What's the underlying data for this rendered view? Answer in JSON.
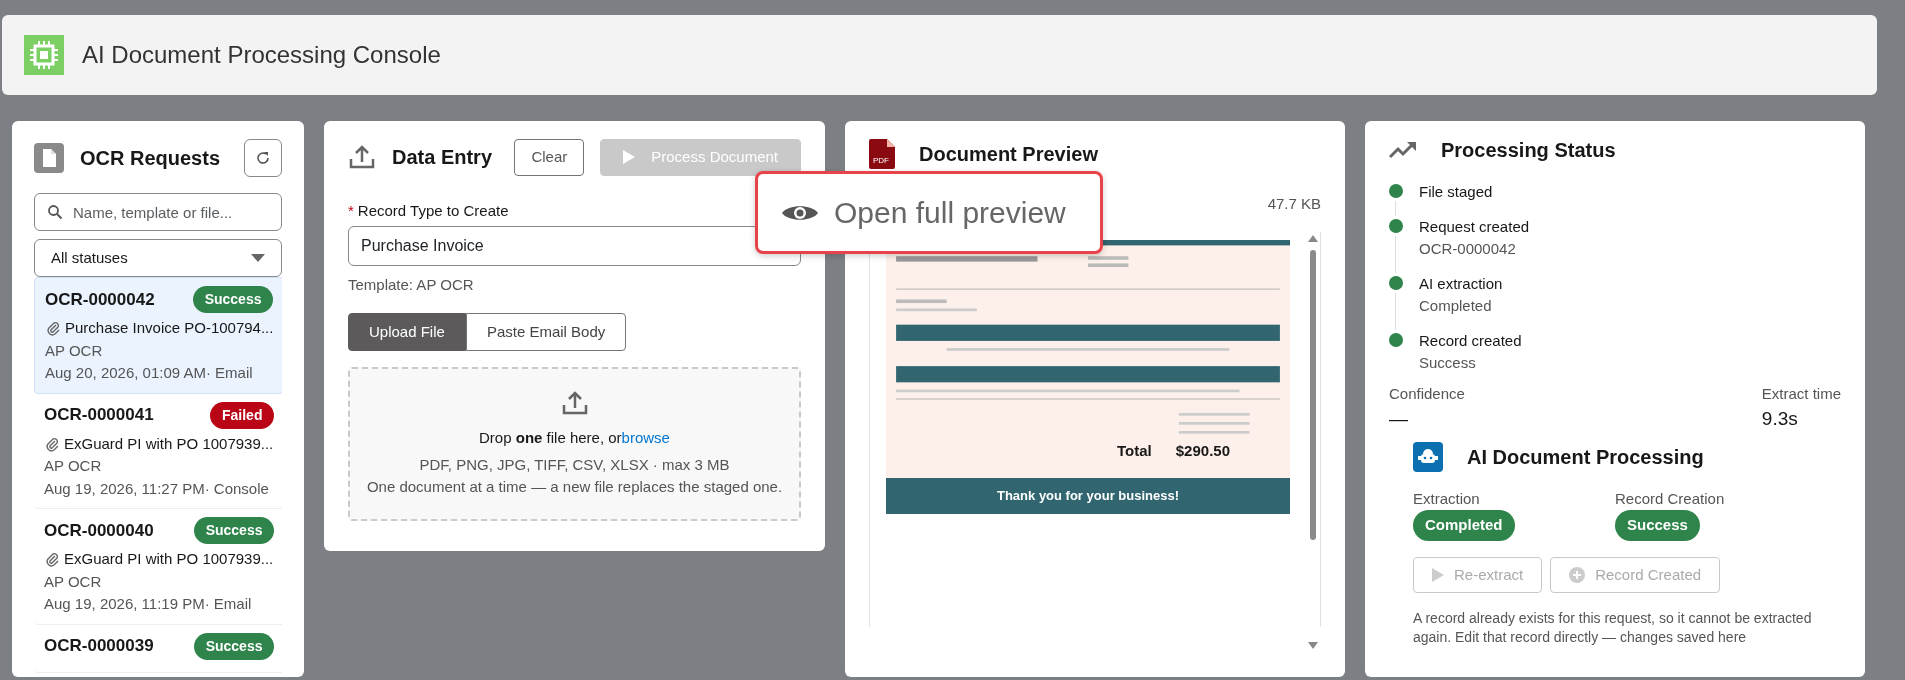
{
  "header": {
    "title": "AI Document Processing Console"
  },
  "requests": {
    "title": "OCR Requests",
    "search": {
      "placeholder": "Name, template or file..."
    },
    "status_filter": "All statuses",
    "items": [
      {
        "id": "OCR-0000042",
        "status": "Success",
        "kind": "success",
        "file": "Purchase Invoice PO-100794...",
        "template": "AP OCR",
        "meta": "Aug 20, 2026, 01:09 AM· Email",
        "selected": true
      },
      {
        "id": "OCR-0000041",
        "status": "Failed",
        "kind": "failed",
        "file": "ExGuard PI with PO 1007939...",
        "template": "AP OCR",
        "meta": "Aug 19, 2026, 11:27 PM· Console",
        "selected": false
      },
      {
        "id": "OCR-0000040",
        "status": "Success",
        "kind": "success",
        "file": "ExGuard PI with PO 1007939...",
        "template": "AP OCR",
        "meta": "Aug 19, 2026, 11:19 PM· Email",
        "selected": false
      },
      {
        "id": "OCR-0000039",
        "status": "Success",
        "kind": "success",
        "selected": false
      }
    ]
  },
  "data_entry": {
    "title": "Data Entry",
    "clear": {
      "label": "Clear"
    },
    "process": {
      "label": "Process Document",
      "disabled": true
    },
    "record_type": {
      "label": "Record Type to Create",
      "required_mark": "*",
      "value": "Purchase Invoice"
    },
    "template": "Template: AP OCR",
    "tabs": [
      {
        "label": "Upload File",
        "selected": true
      },
      {
        "label": "Paste Email Body",
        "selected": false
      }
    ],
    "dropzone": {
      "text": "Drop **one** file here, or",
      "link": "browse",
      "formats": "PDF, PNG, JPG, TIFF, CSV, XLSX · max 3 MB",
      "note": "One document at a time — a new file replaces the staged one."
    }
  },
  "preview": {
    "title": "Document Preview",
    "file_icon_label": "PDF",
    "file_size": "47.7 KB",
    "tooltip": "Open full preview",
    "document": {
      "total_label": "Total",
      "total": "$290.50",
      "footer": "Thank you for your business!"
    }
  },
  "status": {
    "title": "Processing Status",
    "steps": [
      {
        "label": "File staged",
        "done": true
      },
      {
        "label": "Request created",
        "detail": "OCR-0000042",
        "done": true
      },
      {
        "label": "AI extraction",
        "detail": "Completed",
        "done": true
      },
      {
        "label": "Record created",
        "detail": "Success",
        "done": true
      }
    ],
    "confidence": {
      "label": "Confidence",
      "value": "—"
    },
    "extract_time": {
      "label": "Extract time",
      "value": "9.3s"
    },
    "ai": {
      "title": "AI Document Processing",
      "extraction": {
        "label": "Extraction",
        "badge": "Completed"
      },
      "record_creation": {
        "label": "Record Creation",
        "badge": "Success"
      },
      "buttons": [
        {
          "label": "Re-extract",
          "kind": "play",
          "disabled": true
        },
        {
          "label": "Record Created",
          "kind": "add",
          "disabled": true
        }
      ],
      "note": "A record already exists for this request, so it cannot be extracted again. Edit that record directly — changes saved here"
    }
  }
}
